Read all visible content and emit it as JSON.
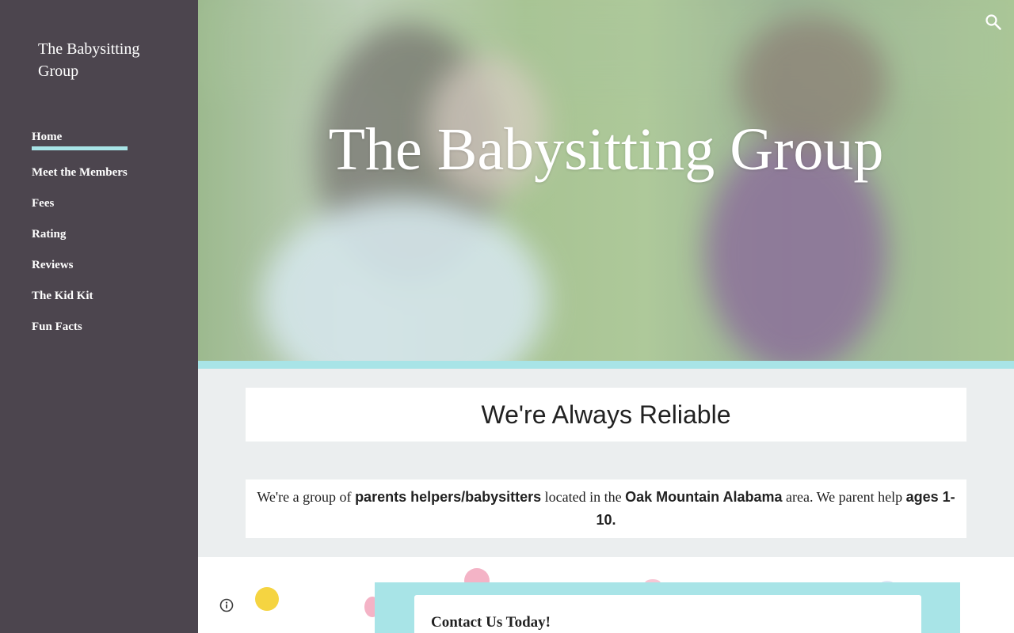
{
  "site": {
    "title": "The Babysitting Group"
  },
  "nav": {
    "items": [
      {
        "label": "Home",
        "active": true
      },
      {
        "label": "Meet the Members"
      },
      {
        "label": "Fees"
      },
      {
        "label": "Rating"
      },
      {
        "label": "Reviews"
      },
      {
        "label": "The Kid Kit"
      },
      {
        "label": "Fun Facts"
      }
    ]
  },
  "hero": {
    "title": "The Babysitting Group",
    "search_icon": "search-icon"
  },
  "main": {
    "heading": "We're Always Reliable",
    "intro": {
      "t1": "We're a group of ",
      "b1": "parents helpers/babysitters",
      "t2": " located in the ",
      "b2": "Oak Mountain Alabama",
      "t3": " area. We parent help ",
      "b3": "ages 1-10."
    }
  },
  "contact": {
    "title": "Contact Us Today!"
  },
  "colors": {
    "sidebar": "#4c454e",
    "accent": "#a8e4e7",
    "section_bg": "#ebeeef"
  }
}
